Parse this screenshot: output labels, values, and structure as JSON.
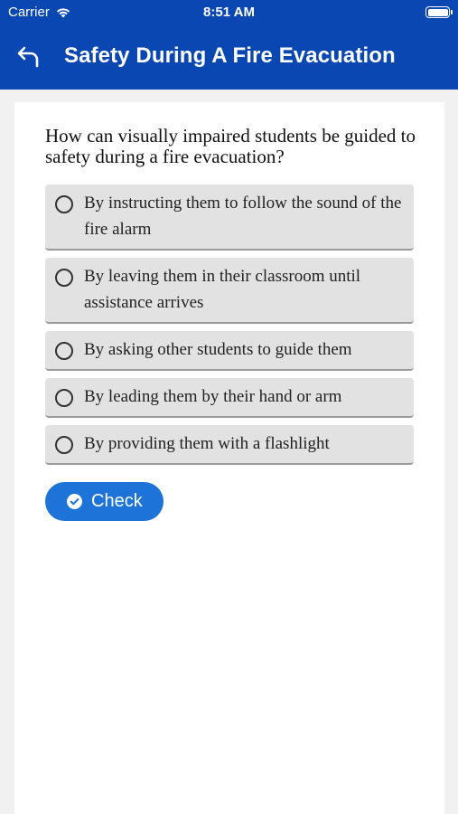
{
  "status_bar": {
    "carrier": "Carrier",
    "time": "8:51 AM",
    "icons": [
      "wifi-icon",
      "battery-icon"
    ]
  },
  "header": {
    "title": "Safety During A Fire Evacuation",
    "back_icon": "back-arrow-icon",
    "background_color": "#0a47b3"
  },
  "quiz": {
    "question": "How can visually impaired students be guided to safety during a fire evacuation?",
    "options": [
      {
        "label": "By instructing them to follow the sound of the fire alarm"
      },
      {
        "label": "By leaving them in their classroom until assistance arrives"
      },
      {
        "label": "By asking other students to guide them"
      },
      {
        "label": "By leading them by their hand or arm"
      },
      {
        "label": "By providing them with a flashlight"
      }
    ],
    "check_button": {
      "label": "Check",
      "icon": "check-circle-icon",
      "color": "#1e73d9"
    }
  }
}
